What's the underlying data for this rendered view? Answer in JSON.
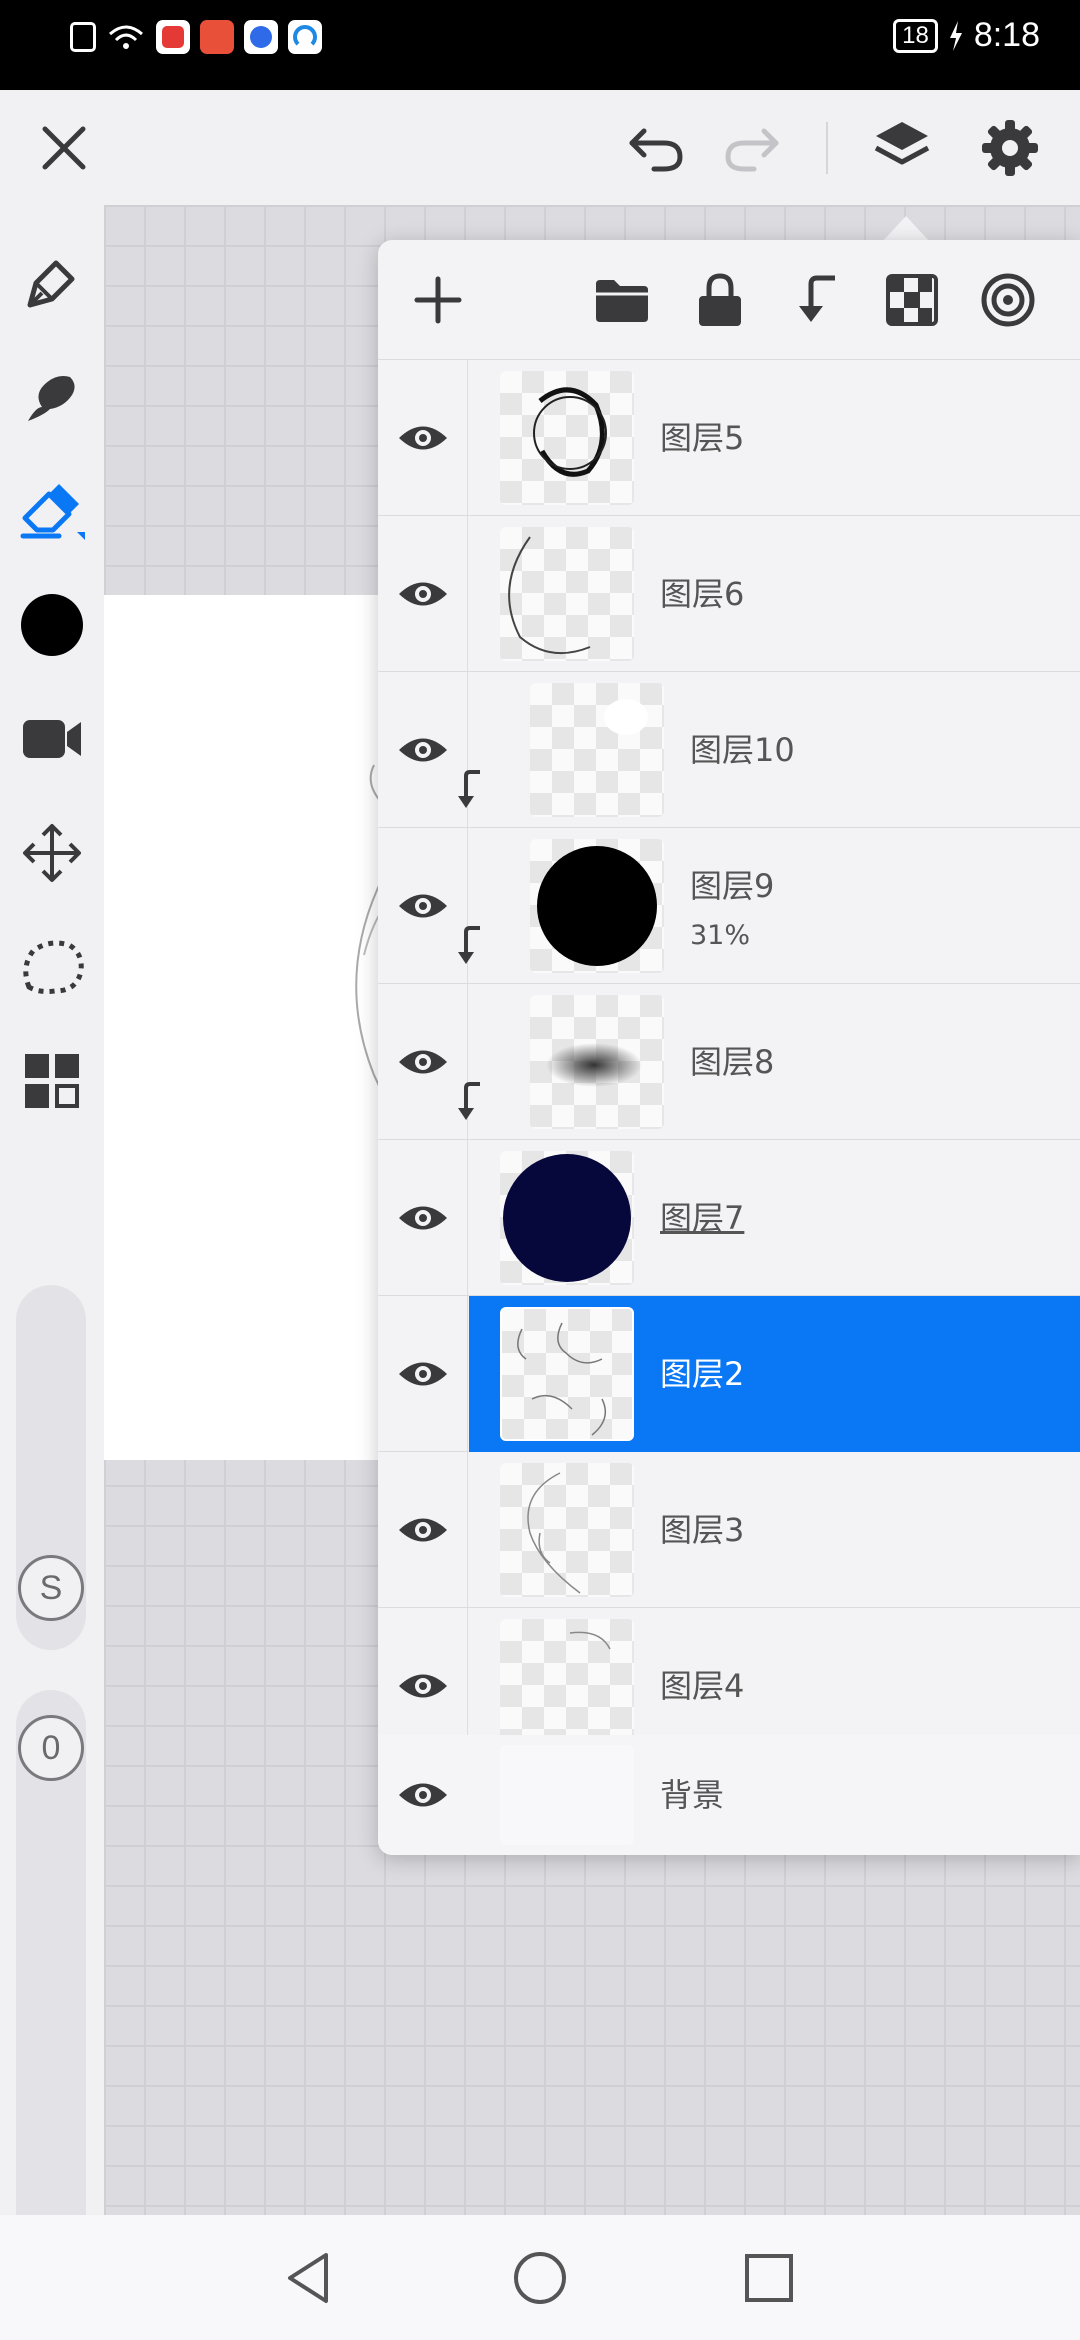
{
  "status_bar": {
    "battery": "18",
    "time": "8:18",
    "colors": {
      "app1": "#e53935",
      "app2": "#e8503a",
      "app3": "#2f6be8",
      "app4": "#1e88e5"
    }
  },
  "toolbar": {
    "icons": [
      "close-icon",
      "undo-icon",
      "redo-icon",
      "layers-icon",
      "settings-icon"
    ]
  },
  "left_tools": {
    "icons": [
      "pen-icon",
      "smudge-icon",
      "eraser-icon",
      "color-swatch",
      "video-icon",
      "transform-icon",
      "lasso-icon",
      "filter-icon"
    ],
    "size_label": "S",
    "opacity_label": "0",
    "brush_color": "#000000",
    "active_color": "#0a78f5"
  },
  "layers_panel": {
    "header_icons": [
      "add-layer-icon",
      "folder-icon",
      "lock-icon",
      "clip-icon",
      "transparency-icon",
      "blend-icon"
    ],
    "layers": [
      {
        "name": "图层5"
      },
      {
        "name": "图层6"
      },
      {
        "name": "图层10"
      },
      {
        "name": "图层9",
        "opacity": "31%"
      },
      {
        "name": "图层8"
      },
      {
        "name": "图层7"
      },
      {
        "name": "图层2"
      },
      {
        "name": "图层3"
      },
      {
        "name": "图层4"
      },
      {
        "name": "背景"
      }
    ],
    "selected_color": "#0a78f5",
    "layer7_color": "#06073a"
  },
  "nav_bar": {
    "icons": [
      "back-icon",
      "home-icon",
      "recents-icon"
    ]
  }
}
